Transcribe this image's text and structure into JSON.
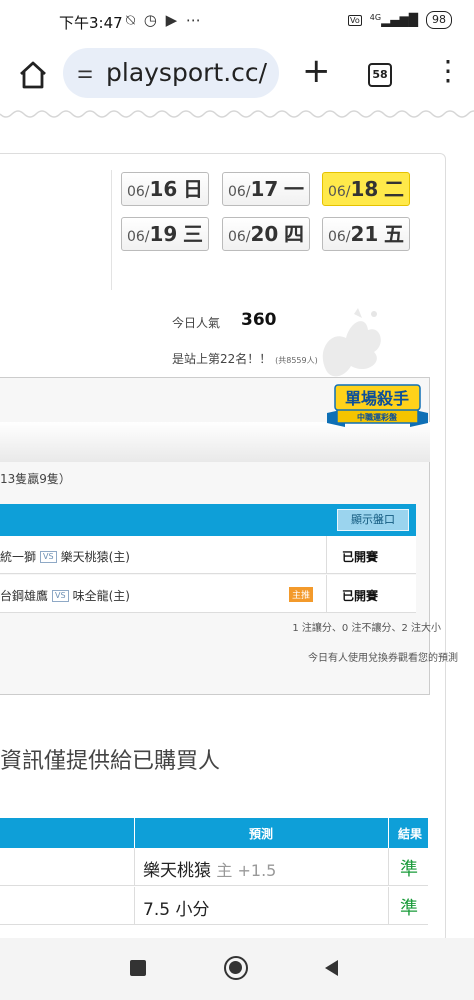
{
  "status_bar": {
    "time": "下午3:47",
    "left_icons": "⍉ ◷ ▶ ⋯",
    "network": "4G",
    "battery": "98"
  },
  "browser": {
    "url": "playsport.cc/",
    "tab_count": "58"
  },
  "dates": [
    {
      "day": "06/",
      "num": "16",
      "wd": "日",
      "selected": false
    },
    {
      "day": "06/",
      "num": "17",
      "wd": "一",
      "selected": false
    },
    {
      "day": "06/",
      "num": "18",
      "wd": "二",
      "selected": true
    },
    {
      "day": "06/",
      "num": "19",
      "wd": "三",
      "selected": false
    },
    {
      "day": "06/",
      "num": "20",
      "wd": "四",
      "selected": false
    },
    {
      "day": "06/",
      "num": "21",
      "wd": "五",
      "selected": false
    }
  ],
  "popularity": {
    "label": "今日人氣",
    "value": "360",
    "rank": "是站上第22名！！",
    "rank_note": "(共8559人)"
  },
  "badge": {
    "title": "單場殺手",
    "subtitle": "中職運彩盤"
  },
  "record_text": "13隻贏9隻）",
  "odds_button": "顯示盤口",
  "games": [
    {
      "away": "統一獅",
      "vs": "VS",
      "home": "樂天桃猿(主)",
      "tag": "",
      "status": "已開賽"
    },
    {
      "away": "台鋼雄鷹",
      "vs": "VS",
      "home": "味全龍(主)",
      "tag": "主推",
      "status": "已開賽"
    }
  ],
  "legend_text": "1 注讓分、0 注不讓分、2 注大小",
  "voucher_text": "今日有人使用兌換券觀看您的預測",
  "notice": "資訊僅提供給已購買人",
  "predictions": {
    "header_pick": "預測",
    "header_result": "結果",
    "rows": [
      {
        "pick": "樂天桃猿",
        "sub": "主 +1.5",
        "result": "準"
      },
      {
        "pick": "7.5 小分",
        "sub": "",
        "result": "準"
      }
    ]
  },
  "colors": {
    "accent_blue": "#0e9fd8",
    "selected_date": "#ffe94a",
    "win_green": "#1a9b3a"
  }
}
